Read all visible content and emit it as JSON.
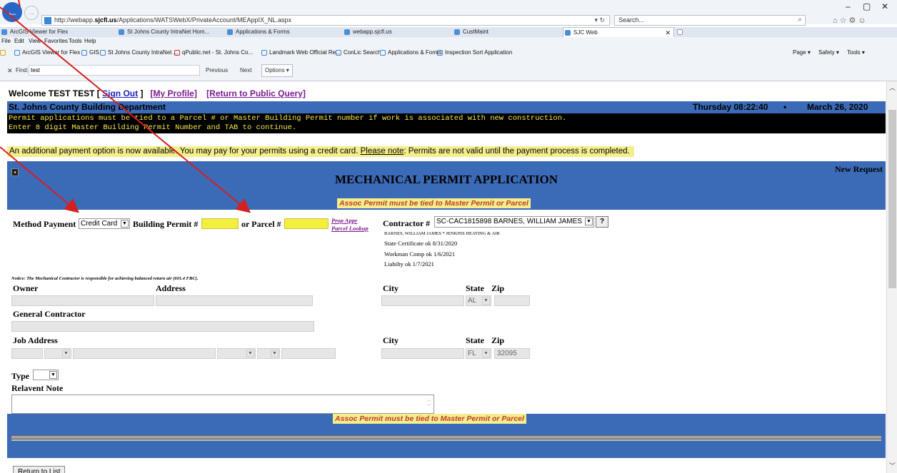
{
  "browser": {
    "url_prefix": "http://webapp.",
    "url_domain": "sjcfl.us",
    "url_path": "/Applications/WATSWebX/PrivateAccount/MEAppIX_NL.aspx",
    "refresh_glyph": "▾ ↻",
    "search_placeholder": "Search...",
    "tabs": [
      {
        "label": "ArcGIS Viewer for Flex"
      },
      {
        "label": "St Johns County IntraNet Hom..."
      },
      {
        "label": "Applications & Forms"
      },
      {
        "label": "webapp.sjcfl.us"
      },
      {
        "label": "CustMaint"
      },
      {
        "label": "SJC Web",
        "active": true
      }
    ],
    "menu": [
      "File",
      "Edit",
      "View",
      "Favorites",
      "Tools",
      "Help"
    ],
    "favorites": [
      "ArcGIS Viewer for Flex",
      "GIS",
      "St Johns County IntraNet ...",
      "qPublic.net - St. Johns Co...",
      "Landmark Web Official Re...",
      "ConLic Search",
      "Applications & Forms",
      "Inspection Sort Application"
    ],
    "commands": [
      "Page ▾",
      "Safety ▾",
      "Tools ▾"
    ],
    "find": {
      "label": "Find:",
      "value": "test",
      "previous": "Previous",
      "next": "Next",
      "options": "Options ▾"
    }
  },
  "page": {
    "welcome": "Welcome TEST TEST",
    "sign_out": "Sign Out",
    "my_profile": "[My Profile]",
    "return_public": "[Return to Public Query]",
    "department": "St. Johns County Building Department",
    "day_time": "Thursday 08:22:40",
    "date_sep": "•",
    "date": "March 26, 2020",
    "notice_line1": "Permit applications must be tied to a Parcel # or Master Building Permit number if work is associated with new construction.",
    "notice_line2": "Enter 8 digit Master Building Permit Number and TAB to continue.",
    "pay_banner_a": "An additional payment option is now available.  You may pay for your permits using a credit card.  ",
    "pay_banner_note": "Please note",
    "pay_banner_b": ": Permits are not valid until the payment process is completed.",
    "form_title": "MECHANICAL PERMIT APPLICATION",
    "new_request": "New Request",
    "assoc_note": "Assoc Permit must be tied to Master Permit or Parcel",
    "method_payment_label": "Method Payment",
    "method_payment_value": "Credit Card",
    "building_permit_label": "Building Permit #",
    "or_parcel_label": "or Parcel #",
    "prop_appr": "Prop Appr",
    "parcel_lookup": "Parcel Lookup",
    "contractor_label": "Contractor #",
    "contractor_value": "SC-CAC1815898 BARNES, WILLIAM JAMES",
    "help_btn": "?",
    "contractor_name": "BARNES, WILLIAM JAMES * JENKINS HEATING & AIR",
    "state_cert": "State Certificate ok 8/31/2020",
    "workman_comp": "Workman Comp ok 1/6/2021",
    "liability": "Liabilty ok 1/7/2021",
    "mech_notice": "Notice: The Mechanical Contractor is responsible for achieving balanced return air (601.4 FBC).",
    "owner_label": "Owner",
    "address_label": "Address",
    "city_label": "City",
    "state_label": "State",
    "zip_label": "Zip",
    "owner_state": "AL",
    "gc_label": "General Contractor",
    "job_address_label": "Job Address",
    "job_state": "FL",
    "job_zip": "32095",
    "type_label": "Type",
    "relavent_note_label": "Relavent Note",
    "return_to_list": "Return to List"
  },
  "colors": {
    "panel_blue": "#3b6ab7",
    "notice_text": "#f5e94a",
    "banner_yellow": "#f4ef8c",
    "field_yellow": "#f4ef3a",
    "annotation_red": "#d42020"
  }
}
